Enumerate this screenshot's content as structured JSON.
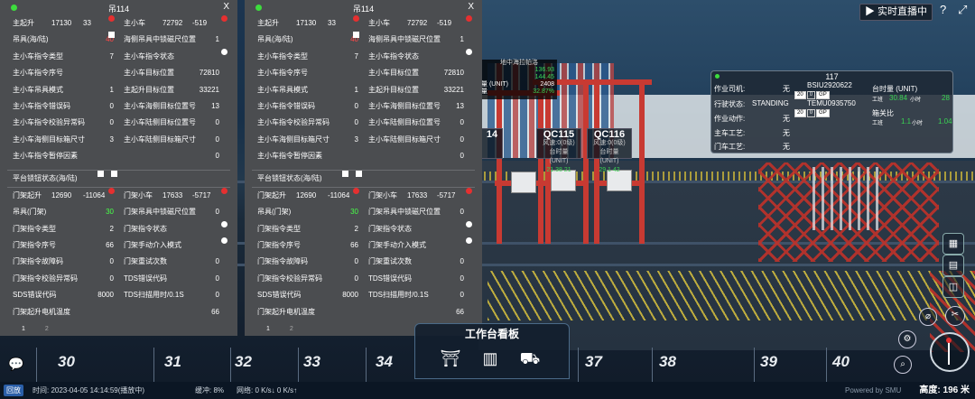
{
  "left_panel": {
    "title": "吊114",
    "close": "X",
    "section1": [
      {
        "l1": "主起升",
        "v1a": "17130",
        "v1b": "33",
        "d1": "red",
        "l2": "主小车",
        "v2a": "72792",
        "v2b": "-519",
        "d2": "red"
      },
      {
        "l1": "吊具(海/陆)",
        "v1": "40",
        "v1color": "red",
        "d1": "box",
        "l2": "海侧吊具中锁磁尺位置",
        "v2": "1"
      },
      {
        "l1": "主小车指令类型",
        "v1": "7",
        "l2": "主小车指令状态",
        "d2": "white"
      },
      {
        "l1": "主小车指令序号",
        "v1": "",
        "l2": "主小车目标位置",
        "v2": "72810"
      },
      {
        "l1": "主小车吊具模式",
        "v1": "1",
        "l2": "主起升目标位置",
        "v2": "33221"
      },
      {
        "l1": "主小车指令错误码",
        "v1": "0",
        "l2": "主小车海侧目标位置号",
        "v2": "13"
      },
      {
        "l1": "主小车指令校验异常码",
        "v1": "0",
        "l2": "主小车陆侧目标位置号",
        "v2": "0"
      },
      {
        "l1": "主小车海侧目标箱尺寸",
        "v1": "3",
        "l2": "主小车陆侧目标箱尺寸",
        "v2": "0"
      },
      {
        "l1": "主小车指令暂停因素",
        "v1": "",
        "l2": "",
        "v2": "0"
      }
    ],
    "platform_label": "平台锁钮状态(海/陆)",
    "section2": [
      {
        "l1": "门架起升",
        "v1a": "12690",
        "v1b": "-11064",
        "d1": "red",
        "l2": "门架小车",
        "v2a": "17633",
        "v2b": "-5717",
        "d2": "red"
      },
      {
        "l1": "吊具(门架)",
        "v1": "30",
        "v1color": "green",
        "l2": "门架吊具中锁磁尺位置",
        "v2": "0"
      },
      {
        "l1": "门架指令类型",
        "v1": "2",
        "l2": "门架指令状态",
        "d2": "white"
      },
      {
        "l1": "门架指令序号",
        "v1": "66",
        "l2": "门架手动介入模式",
        "d2": "white"
      },
      {
        "l1": "门架指令故障码",
        "v1": "0",
        "l2": "门架重试次数",
        "v2": "0"
      },
      {
        "l1": "门架指令校验异常码",
        "v1": "0",
        "l2": "TDS错误代码",
        "v2": "0"
      },
      {
        "l1": "SDS错误代码",
        "v1": "8000",
        "l2": "TDS扫描用时/0.1S",
        "v2": "0"
      },
      {
        "l1": "门架起升电机温度",
        "v1": "",
        "l2": "",
        "v2": "66"
      }
    ],
    "pages": [
      "1",
      "2"
    ]
  },
  "scene": {
    "ship_panel": {
      "title": "地中海拉帕洛",
      "rows": [
        {
          "k": "",
          "v": "136.93"
        },
        {
          "k": "",
          "v": "144.45"
        },
        {
          "k": "量 (UNIT)",
          "v": "2408"
        },
        {
          "k": "量",
          "v": "32.87%"
        }
      ]
    },
    "cranes": [
      {
        "name": "14",
        "sub": "",
        "val": ""
      },
      {
        "name": "QC115",
        "sub": "风速:0(0级)",
        "line2": "台时量 (UNIT)",
        "val": "21.38 21"
      },
      {
        "name": "QC116",
        "sub": "风速:0(0级)",
        "line2": "台时量 (UNIT)",
        "val": "29.1 42"
      }
    ],
    "bay_numbers": [
      "30",
      "31",
      "32",
      "33",
      "34",
      "37",
      "38",
      "39",
      "40"
    ]
  },
  "info117": {
    "title": "117",
    "rows": [
      {
        "k": "作业司机:",
        "v": "无"
      },
      {
        "k": "行驶状态:",
        "v": "STANDING"
      },
      {
        "k": "作业动作:",
        "v": "无"
      },
      {
        "k": "主车工艺:",
        "v": "无"
      },
      {
        "k": "门车工艺:",
        "v": "无"
      }
    ],
    "containers": [
      {
        "id": "BSIU2920622",
        "b1": "20",
        "b2": "0",
        "b3": "GP"
      },
      {
        "id": "TEMU0935750",
        "b1": "20",
        "b2": "0",
        "b3": "GP"
      }
    ],
    "tsl_label": "台时量 (UNIT)",
    "work_label": "工班",
    "work_value": "30.84",
    "work_unit": "小时",
    "work_count": "28",
    "gangguan_label": "箱关比",
    "gg_work_label": "工班",
    "gg_value": "1.1",
    "gg_unit": "小时",
    "gg_count": "1.04"
  },
  "top": {
    "live": "实时直播中",
    "help": "?"
  },
  "workbench": {
    "title": "工作台看板"
  },
  "status": {
    "back": "回放",
    "time": "时间: 2023-04-05 14:14:59(播放中)",
    "buffer": "缓冲: 8%",
    "net": "网络: 0 K/s↓ 0 K/s↑",
    "powered": "Powered by SMU",
    "height": "高度: 196 米"
  }
}
